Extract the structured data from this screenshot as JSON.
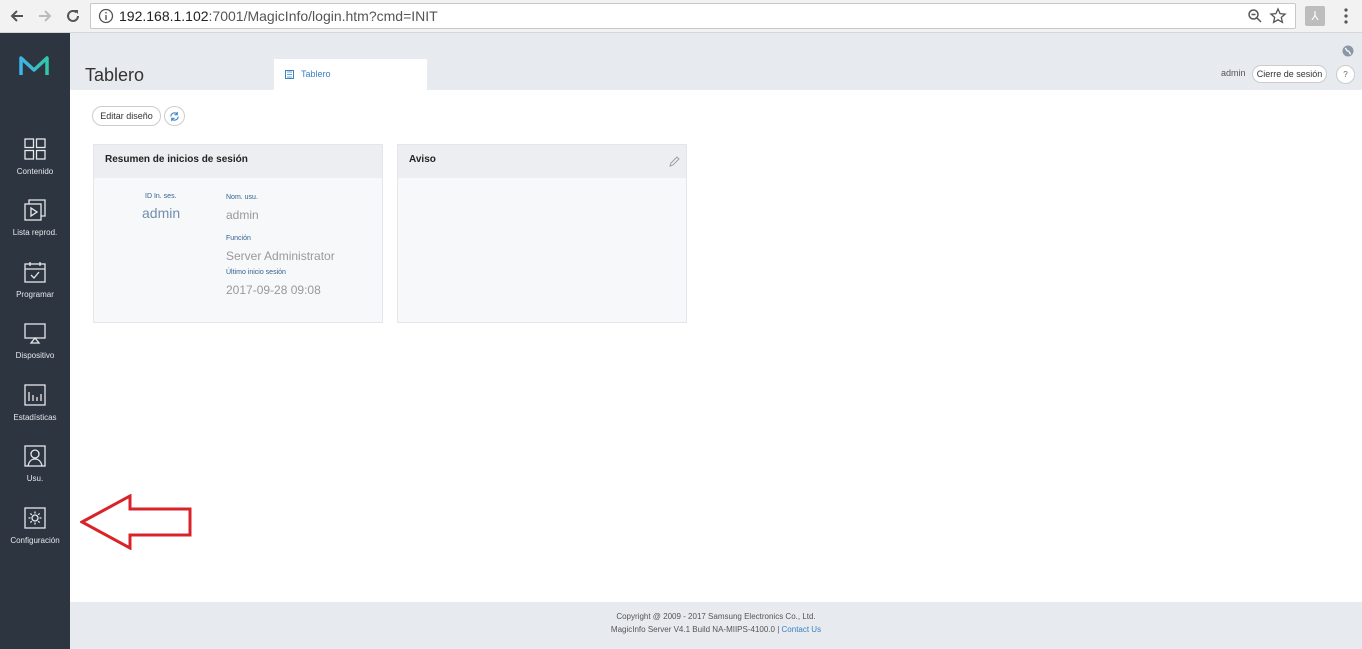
{
  "browser": {
    "url_host": "192.168.1.102",
    "url_rest": ":7001/MagicInfo/login.htm?cmd=INIT"
  },
  "sidebar": {
    "items": [
      {
        "label": "Contenido",
        "icon": "grid-icon"
      },
      {
        "label": "Lista reprod.",
        "icon": "playlist-icon"
      },
      {
        "label": "Programar",
        "icon": "calendar-icon"
      },
      {
        "label": "Dispositivo",
        "icon": "monitor-icon"
      },
      {
        "label": "Estadísticas",
        "icon": "chart-icon"
      },
      {
        "label": "Usu.",
        "icon": "user-icon"
      },
      {
        "label": "Configuración",
        "icon": "settings-icon"
      }
    ]
  },
  "header": {
    "title": "Tablero",
    "tab_label": "Tablero",
    "user": "admin",
    "logout_label": "Cierre de sesión",
    "help_label": "?"
  },
  "toolbar": {
    "edit_label": "Editar diseño"
  },
  "login_card": {
    "title": "Resumen de inicios de sesión",
    "session_id_label": "ID In. ses.",
    "session_id_value": "admin",
    "user_label": "Nom. usu.",
    "user_value": "admin",
    "role_label": "Función",
    "role_value": "Server Administrator",
    "last_login_label": "Último inicio sesión",
    "last_login_value": "2017-09-28 09:08"
  },
  "notice_card": {
    "title": "Aviso"
  },
  "footer": {
    "copyright": "Copyright @ 2009 - 2017 Samsung Electronics Co., Ltd.",
    "build": "MagicInfo Server V4.1 Build NA-MIIPS-4100.0 |",
    "contact": "Contact Us"
  },
  "colors": {
    "sidebar_bg": "#2d3541",
    "accent": "#3a82c4",
    "arrow": "#d9232b"
  }
}
